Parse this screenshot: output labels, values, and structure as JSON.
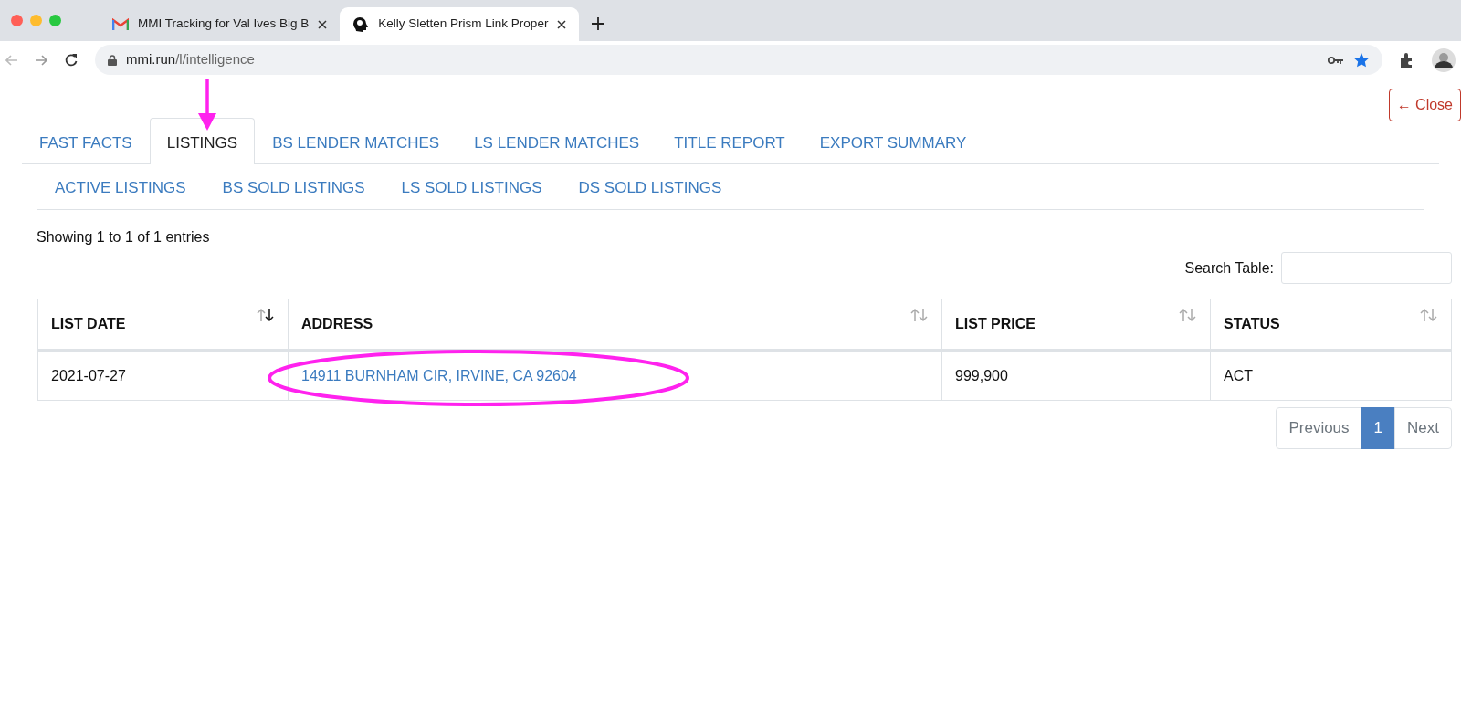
{
  "browser": {
    "tabs": [
      {
        "title": "MMI Tracking for Val Ives Big B",
        "selected": false
      },
      {
        "title": "Kelly Sletten Prism Link Proper",
        "selected": true
      }
    ],
    "url_host": "mmi.run",
    "url_path": "/l/intelligence"
  },
  "close_button": "← Close",
  "tabs": [
    {
      "label": "FAST FACTS",
      "selected": false
    },
    {
      "label": "LISTINGS",
      "selected": true
    },
    {
      "label": "BS LENDER MATCHES",
      "selected": false
    },
    {
      "label": "LS LENDER MATCHES",
      "selected": false
    },
    {
      "label": "TITLE REPORT",
      "selected": false
    },
    {
      "label": "EXPORT SUMMARY",
      "selected": false
    }
  ],
  "subtabs": [
    {
      "label": "ACTIVE LISTINGS",
      "selected": false
    },
    {
      "label": "BS SOLD LISTINGS",
      "selected": false
    },
    {
      "label": "LS SOLD LISTINGS",
      "selected": false
    },
    {
      "label": "DS SOLD LISTINGS",
      "selected": false
    }
  ],
  "info": "Showing 1 to 1 of 1 entries",
  "search_label": "Search Table:",
  "table": {
    "columns": [
      {
        "label": "LIST DATE",
        "sorted": true
      },
      {
        "label": "ADDRESS",
        "sorted": false
      },
      {
        "label": "LIST PRICE",
        "sorted": false
      },
      {
        "label": "STATUS",
        "sorted": false
      }
    ],
    "rows": [
      {
        "kind": "listing",
        "cells": [
          "2021-07-27",
          "14911 BURNHAM CIR, IRVINE, CA 92604",
          "999,900",
          "ACT"
        ]
      }
    ]
  },
  "pagination": [
    {
      "label": "Previous",
      "selected": false
    },
    {
      "label": "1",
      "selected": true
    },
    {
      "label": "Next",
      "selected": false
    }
  ]
}
